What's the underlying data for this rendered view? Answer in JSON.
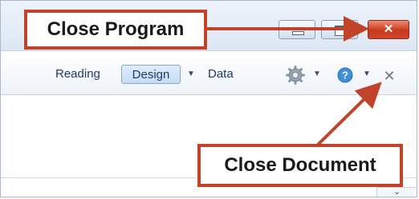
{
  "window": {
    "minimize_icon": "minimize-icon",
    "maximize_icon": "maximize-icon",
    "close_icon": "close-icon",
    "close_glyph": "✕",
    "close_color": "#c9381d"
  },
  "ribbon": {
    "tabs": [
      {
        "label": "Reading",
        "active": false
      },
      {
        "label": "Design",
        "active": true
      },
      {
        "label": "Data",
        "active": false
      }
    ],
    "design_dropdown_glyph": "▼",
    "options_icon": "gear-icon",
    "options_dropdown_glyph": "▼",
    "help_icon": "help-icon",
    "help_dropdown_glyph": "▼",
    "close_document_icon": "close-document-icon",
    "close_document_glyph": "✕"
  },
  "footer": {
    "expand_icon": "double-chevron-down-icon",
    "expand_glyph": "⌄"
  },
  "annotations": {
    "close_program": "Close Program",
    "close_document": "Close Document",
    "accent_color": "#c0432a"
  }
}
